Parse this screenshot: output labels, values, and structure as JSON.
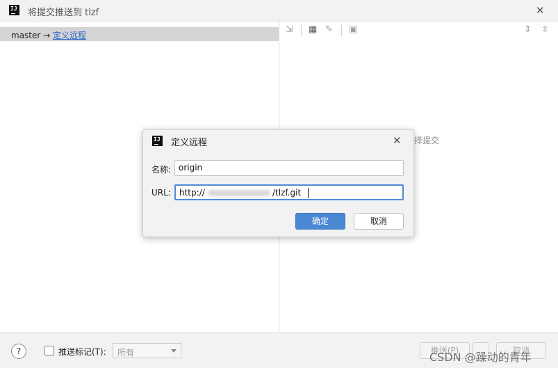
{
  "window": {
    "title": "将提交推送到 tlzf",
    "logo_text": "IJ",
    "close_glyph": "✕"
  },
  "left_pane": {
    "branch": "master",
    "arrow": "→",
    "remote_link": "定义远程"
  },
  "right_pane": {
    "placeholder_visible": "择提交"
  },
  "bottom_bar": {
    "help_glyph": "?",
    "push_tags_label": "推送标记(T):",
    "tags_select_value": "所有",
    "push_button_visible": "推送(P)",
    "cancel_button_visible": "取消"
  },
  "watermark": "CSDN @躁动的青年",
  "dialog": {
    "title": "定义远程",
    "logo_text": "IJ",
    "close_glyph": "✕",
    "name_label": "名称:",
    "name_value": "origin",
    "url_label": "URL:",
    "url_prefix": "http://",
    "url_suffix": "/tlzf.git",
    "ok_label": "确定",
    "cancel_label": "取消"
  },
  "colors": {
    "accent": "#4a88d3",
    "link": "#2a67c7",
    "selection_row": "#d4d4d4"
  }
}
